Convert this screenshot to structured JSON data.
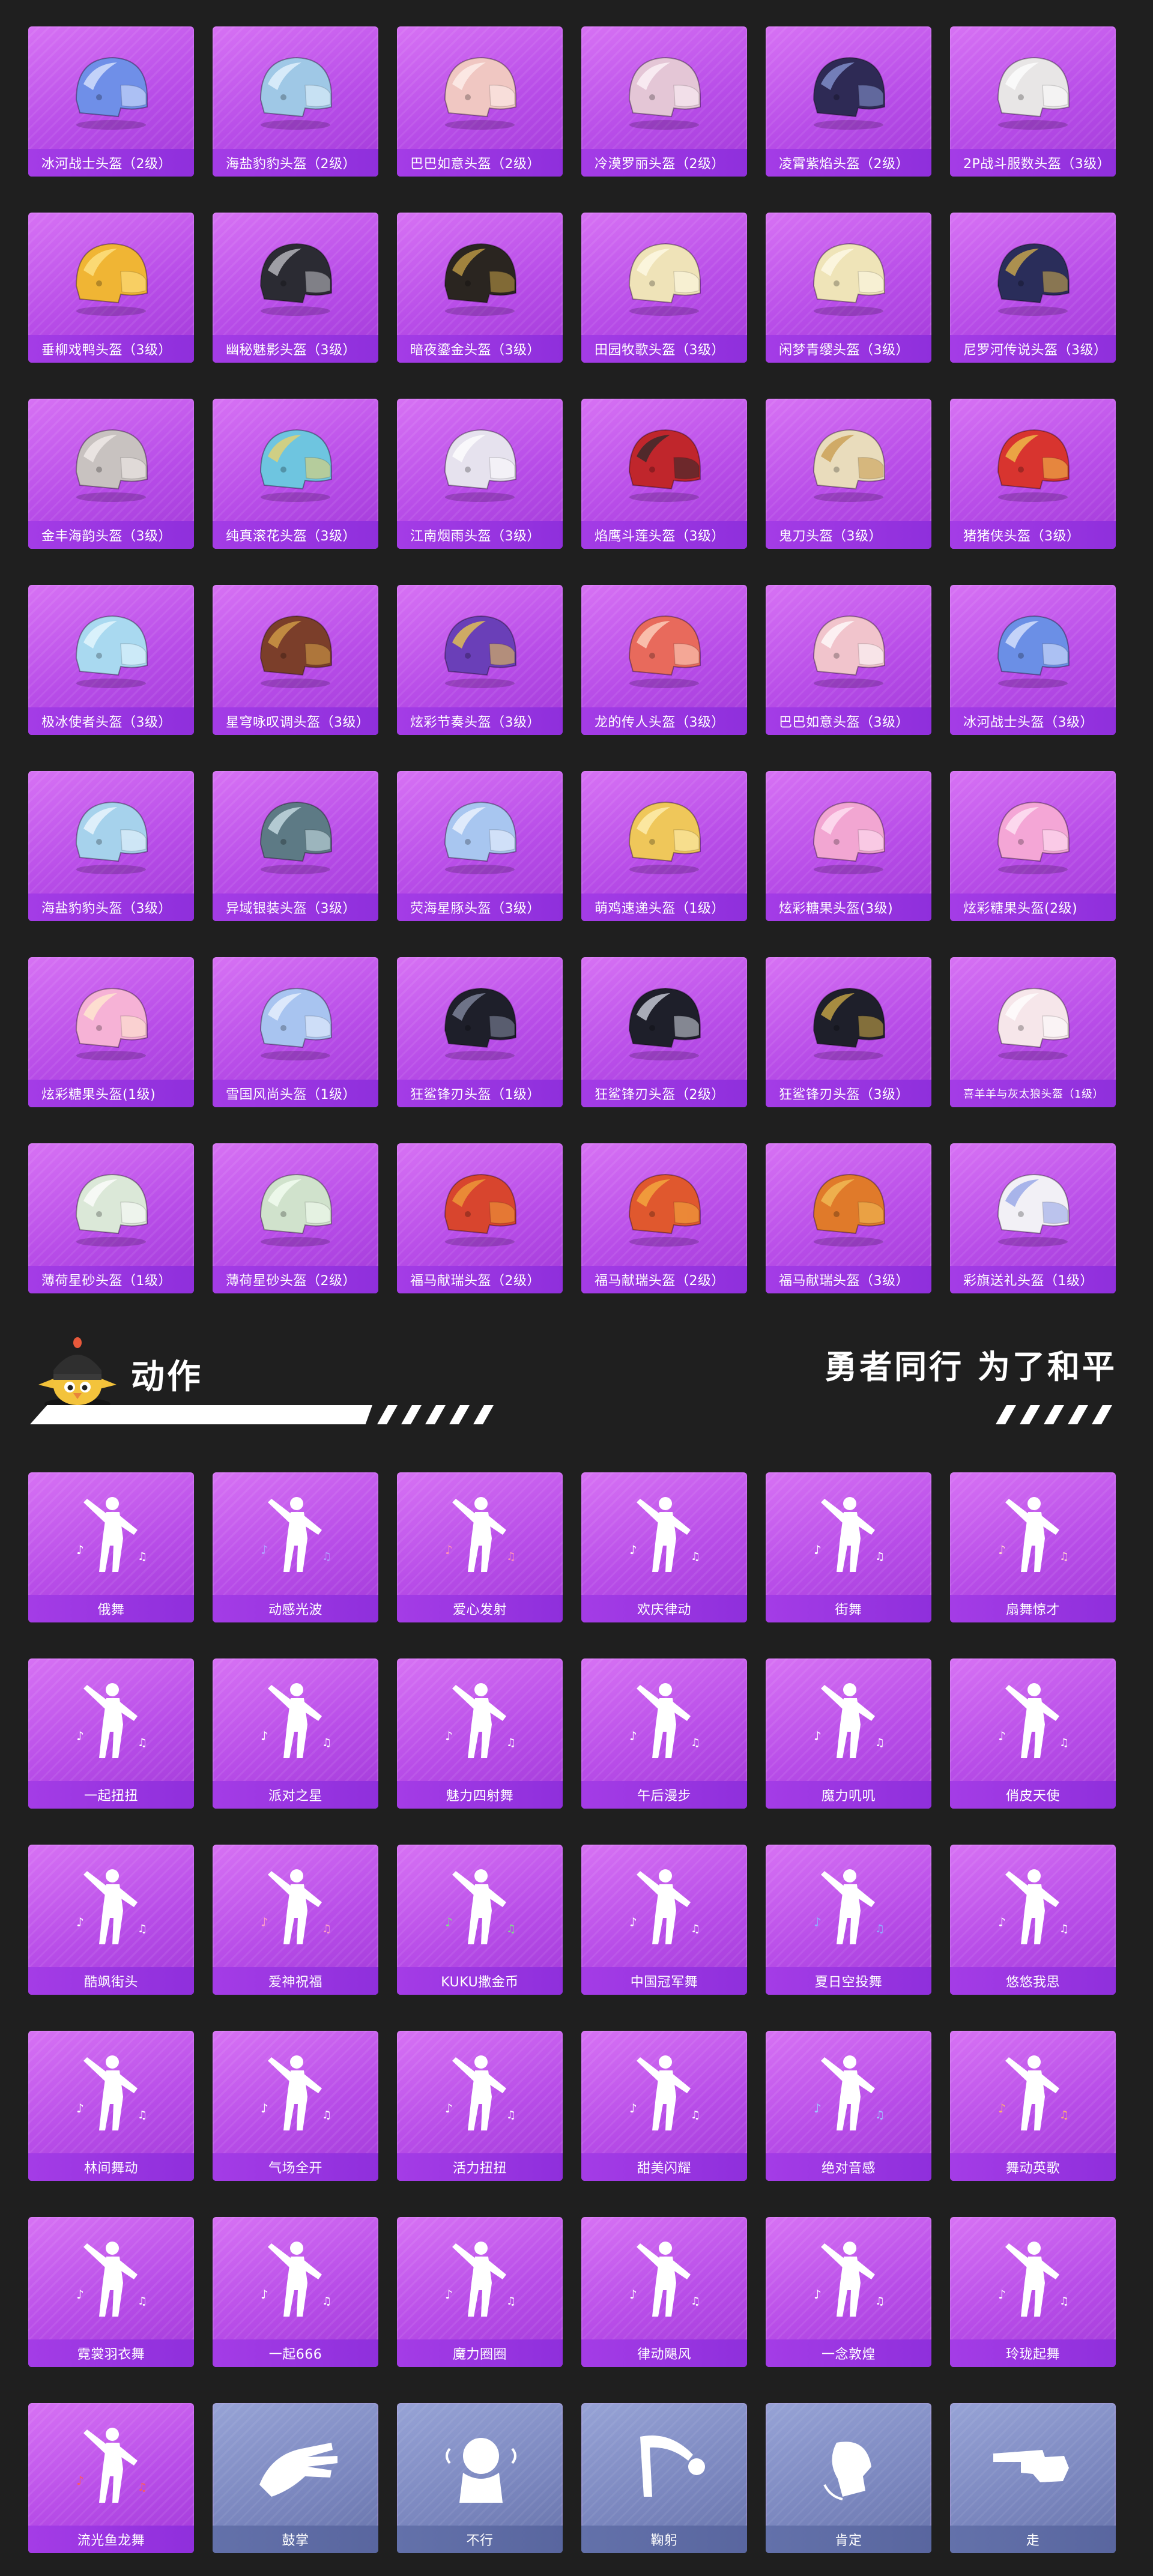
{
  "section": {
    "title": "动作",
    "slogan": "勇者同行 为了和平",
    "mascot_icon": "chicken-helmet-mascot-icon"
  },
  "colors": {
    "background": "#1f1f1f",
    "card_purple": "#c256ee",
    "card_blue": "#7a86bd",
    "label_purple": "#9a36e0",
    "label_blue": "#5e6ba4"
  },
  "helmets": [
    {
      "label": "冰河战士头盔（2级）",
      "icon": "helmet-icon",
      "c1": "#6f8fe8",
      "c2": "#dfe8ff"
    },
    {
      "label": "海盐豹豹头盔（2级）",
      "icon": "helmet-icon",
      "c1": "#9fc8e6",
      "c2": "#e8f6ff"
    },
    {
      "label": "巴巴如意头盔（2级）",
      "icon": "helmet-icon",
      "c1": "#f0c7c2",
      "c2": "#fff2ee"
    },
    {
      "label": "冷漠罗丽头盔（2级）",
      "icon": "helmet-icon",
      "c1": "#e4c6d6",
      "c2": "#fff5f9"
    },
    {
      "label": "凌霄紫焰头盔（2级）",
      "icon": "helmet-icon",
      "c1": "#2e2a55",
      "c2": "#8b9bd9"
    },
    {
      "label": "2P战斗服数头盔（3级）",
      "icon": "helmet-icon",
      "c1": "#e8e6e6",
      "c2": "#ffffff"
    },
    {
      "label": "垂柳戏鸭头盔（3级）",
      "icon": "helmet-icon",
      "c1": "#f0b534",
      "c2": "#ffe58a"
    },
    {
      "label": "幽秘魅影头盔（3级）",
      "icon": "helmet-icon",
      "c1": "#2b2b33",
      "c2": "#c6c6cc"
    },
    {
      "label": "暗夜鎏金头盔（3级）",
      "icon": "helmet-icon",
      "c1": "#2a2520",
      "c2": "#c9a348"
    },
    {
      "label": "田园牧歌头盔（3级）",
      "icon": "helmet-icon",
      "c1": "#efe3b8",
      "c2": "#fffbe8"
    },
    {
      "label": "闲梦青缨头盔（3级）",
      "icon": "helmet-icon",
      "c1": "#efe4b8",
      "c2": "#fffbea"
    },
    {
      "label": "尼罗河传说头盔（3级）",
      "icon": "helmet-icon",
      "c1": "#2a2d5a",
      "c2": "#d8b24c"
    },
    {
      "label": "金丰海韵头盔（3级）",
      "icon": "helmet-icon",
      "c1": "#c8c2c0",
      "c2": "#f4eeec"
    },
    {
      "label": "纯真滚花头盔（3级）",
      "icon": "helmet-icon",
      "c1": "#6ec5e0",
      "c2": "#f0d266"
    },
    {
      "label": "江南烟雨头盔（3级）",
      "icon": "helmet-icon",
      "c1": "#e6e2ee",
      "c2": "#ffffff"
    },
    {
      "label": "焰鹰斗莲头盔（3级）",
      "icon": "helmet-icon",
      "c1": "#c0262c",
      "c2": "#2b2b2b"
    },
    {
      "label": "鬼刀头盔（3级）",
      "icon": "helmet-icon",
      "c1": "#e9dcbc",
      "c2": "#c79a4a"
    },
    {
      "label": "猪猪侠头盔（3级）",
      "icon": "helmet-icon",
      "c1": "#d8342f",
      "c2": "#f2c94c"
    },
    {
      "label": "极冰使者头盔（3级）",
      "icon": "helmet-icon",
      "c1": "#a9d9f0",
      "c2": "#eaf8ff"
    },
    {
      "label": "星穹咏叹调头盔（3级）",
      "icon": "helmet-icon",
      "c1": "#7b3e2a",
      "c2": "#d8a44a"
    },
    {
      "label": "炫彩节奏头盔（3级）",
      "icon": "helmet-icon",
      "c1": "#6a3fb8",
      "c2": "#f0d04a"
    },
    {
      "label": "龙的传人头盔（3级）",
      "icon": "helmet-icon",
      "c1": "#e86a5c",
      "c2": "#ffd9c6"
    },
    {
      "label": "巴巴如意头盔（3级）",
      "icon": "helmet-icon",
      "c1": "#f1c4cc",
      "c2": "#ffffff"
    },
    {
      "label": "冰河战士头盔（3级）",
      "icon": "helmet-icon",
      "c1": "#6b8fe6",
      "c2": "#e2eaff"
    },
    {
      "label": "海盐豹豹头盔（3级）",
      "icon": "helmet-icon",
      "c1": "#a6d2ec",
      "c2": "#f0f8ff"
    },
    {
      "label": "异域银装头盔（3级）",
      "icon": "helmet-icon",
      "c1": "#5d7a85",
      "c2": "#d0e6ec"
    },
    {
      "label": "荧海星豚头盔（3级）",
      "icon": "helmet-icon",
      "c1": "#a8c6f0",
      "c2": "#f2f6ff"
    },
    {
      "label": "萌鸡速递头盔（1级）",
      "icon": "helmet-icon",
      "c1": "#efc75a",
      "c2": "#fff1b8"
    },
    {
      "label": "炫彩糖果头盔(3级)",
      "icon": "helmet-icon",
      "c1": "#f2a6d2",
      "c2": "#ffe6f4"
    },
    {
      "label": "炫彩糖果头盔(2级)",
      "icon": "helmet-icon",
      "c1": "#f4a6d6",
      "c2": "#ffe8f6"
    },
    {
      "label": "炫彩糖果头盔(1级)",
      "icon": "helmet-icon",
      "c1": "#f6b2d6",
      "c2": "#ffeccd"
    },
    {
      "label": "雪国风尚头盔（1级）",
      "icon": "helmet-icon",
      "c1": "#a8c4f0",
      "c2": "#eef4ff"
    },
    {
      "label": "狂鲨锋刃头盔（1级）",
      "icon": "helmet-icon",
      "c1": "#1e1f2a",
      "c2": "#8a90a8"
    },
    {
      "label": "狂鲨锋刃头盔（2级）",
      "icon": "helmet-icon",
      "c1": "#1e1f2a",
      "c2": "#d8dce8"
    },
    {
      "label": "狂鲨锋刃头盔（3级）",
      "icon": "helmet-icon",
      "c1": "#1e1f2a",
      "c2": "#d6b24a"
    },
    {
      "label": "喜羊羊与灰太狼头盔（1级）",
      "icon": "helmet-icon",
      "c1": "#f6e6ea",
      "c2": "#ffffff",
      "small": true
    },
    {
      "label": "薄荷星砂头盔（1级）",
      "icon": "helmet-icon",
      "c1": "#dbe8d8",
      "c2": "#ffffff"
    },
    {
      "label": "薄荷星砂头盔（2级）",
      "icon": "helmet-icon",
      "c1": "#d0e2cc",
      "c2": "#f6fff4"
    },
    {
      "label": "福马献瑞头盔（2级）",
      "icon": "helmet-icon",
      "c1": "#d8452e",
      "c2": "#f0a23a"
    },
    {
      "label": "福马献瑞头盔（2级）",
      "icon": "helmet-icon",
      "c1": "#e0582e",
      "c2": "#f5b040"
    },
    {
      "label": "福马献瑞头盔（3级）",
      "icon": "helmet-icon",
      "c1": "#e07a2a",
      "c2": "#f3c25a"
    },
    {
      "label": "彩旗送礼头盔（1级）",
      "icon": "helmet-icon",
      "c1": "#f2f0f6",
      "c2": "#8fa0e6"
    }
  ],
  "emotes": [
    {
      "label": "俄舞",
      "icon": "dance-figure-icon",
      "accent": "#ffffff"
    },
    {
      "label": "动感光波",
      "icon": "dance-figure-icon",
      "accent": "#b49cff"
    },
    {
      "label": "爱心发射",
      "icon": "dance-figure-icon",
      "accent": "#ff8fb8"
    },
    {
      "label": "欢庆律动",
      "icon": "dance-figure-icon",
      "accent": "#ffffff"
    },
    {
      "label": "街舞",
      "icon": "dance-figure-icon",
      "accent": "#ffffff"
    },
    {
      "label": "扇舞惊才",
      "icon": "dance-figure-icon",
      "accent": "#ffd0d0"
    },
    {
      "label": "一起扭扭",
      "icon": "dance-figure-icon",
      "accent": "#ffffff"
    },
    {
      "label": "派对之星",
      "icon": "dance-figure-icon",
      "accent": "#ffffff"
    },
    {
      "label": "魅力四射舞",
      "icon": "dance-figure-icon",
      "accent": "#ffffff"
    },
    {
      "label": "午后漫步",
      "icon": "dance-figure-icon",
      "accent": "#ffffff"
    },
    {
      "label": "魔力叽叽",
      "icon": "dance-figure-icon",
      "accent": "#ffffff"
    },
    {
      "label": "俏皮天使",
      "icon": "dance-figure-icon",
      "accent": "#ffffff"
    },
    {
      "label": "酷飒街头",
      "icon": "dance-figure-icon",
      "accent": "#ffffff"
    },
    {
      "label": "爱神祝福",
      "icon": "dance-figure-icon",
      "accent": "#ff9ec8"
    },
    {
      "label": "KUKU撒金币",
      "icon": "dance-figure-icon",
      "accent": "#7fe08a"
    },
    {
      "label": "中国冠军舞",
      "icon": "dance-figure-icon",
      "accent": "#ffffff"
    },
    {
      "label": "夏日空投舞",
      "icon": "dance-figure-icon",
      "accent": "#8fb0ff"
    },
    {
      "label": "悠悠我思",
      "icon": "dance-figure-icon",
      "accent": "#ffffff"
    },
    {
      "label": "林间舞动",
      "icon": "dance-figure-icon",
      "accent": "#ffffff"
    },
    {
      "label": "气场全开",
      "icon": "dance-figure-icon",
      "accent": "#ffffff"
    },
    {
      "label": "活力扭扭",
      "icon": "dance-figure-icon",
      "accent": "#ffffff"
    },
    {
      "label": "甜美闪耀",
      "icon": "dance-figure-icon",
      "accent": "#ffffff"
    },
    {
      "label": "绝对音感",
      "icon": "dance-figure-icon",
      "accent": "#9fc4ff"
    },
    {
      "label": "舞动英歌",
      "icon": "dance-figure-icon",
      "accent": "#ffb070"
    },
    {
      "label": "霓裳羽衣舞",
      "icon": "dance-figure-icon",
      "accent": "#ffffff"
    },
    {
      "label": "一起666",
      "icon": "dance-figure-icon",
      "accent": "#ffffff"
    },
    {
      "label": "魔力圈圈",
      "icon": "dance-figure-icon",
      "accent": "#ffffff"
    },
    {
      "label": "律动飓风",
      "icon": "dance-figure-icon",
      "accent": "#ffffff"
    },
    {
      "label": "一念敦煌",
      "icon": "dance-figure-icon",
      "accent": "#ffffff"
    },
    {
      "label": "玲珑起舞",
      "icon": "dance-figure-icon",
      "accent": "#ffffff"
    },
    {
      "label": "流光鱼龙舞",
      "icon": "dance-figure-icon",
      "accent": "#ff5a5a"
    },
    {
      "label": "鼓掌",
      "icon": "clap-hands-icon",
      "accent": "#ffffff",
      "blue": true
    },
    {
      "label": "不行",
      "icon": "head-shake-icon",
      "accent": "#ffffff",
      "blue": true
    },
    {
      "label": "鞠躬",
      "icon": "bow-icon",
      "accent": "#ffffff",
      "blue": true
    },
    {
      "label": "肯定",
      "icon": "head-nod-icon",
      "accent": "#ffffff",
      "blue": true
    },
    {
      "label": "走",
      "icon": "point-hand-icon",
      "accent": "#ffffff",
      "blue": true
    }
  ]
}
